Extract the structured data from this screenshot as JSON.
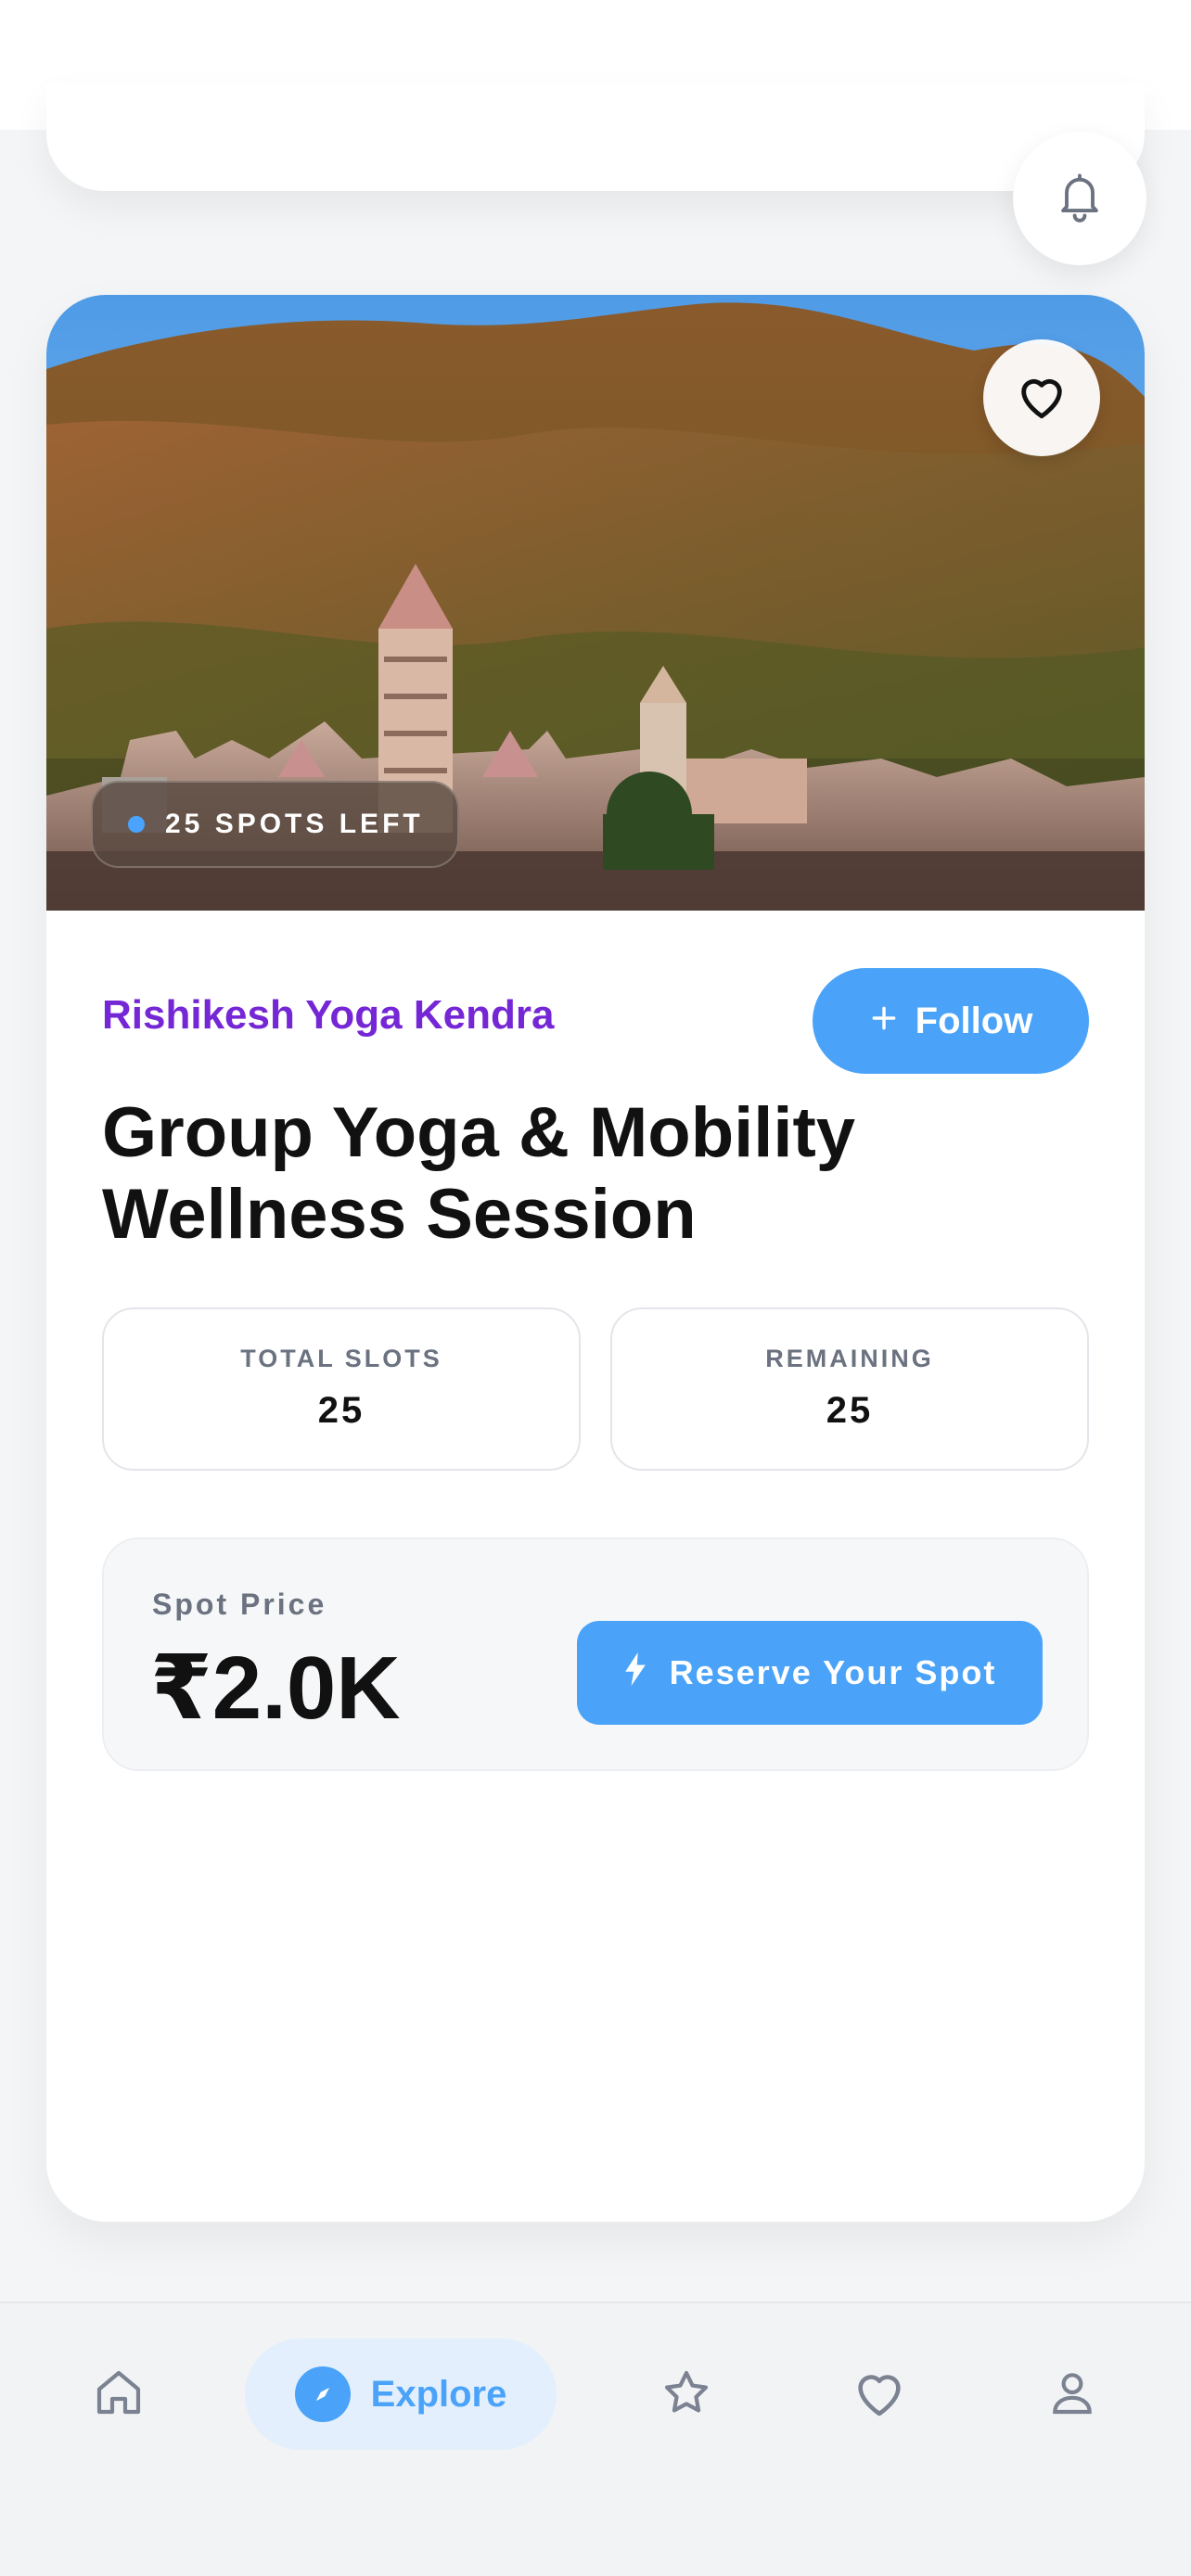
{
  "card": {
    "badge": "25 SPOTS LEFT",
    "organizer": "Rishikesh Yoga Kendra",
    "follow_label": "Follow",
    "title_line1": "Group Yoga & Mobility",
    "title_line2": "Wellness Session",
    "stats": [
      {
        "label": "TOTAL SLOTS",
        "value": "25"
      },
      {
        "label": "REMAINING",
        "value": "25"
      }
    ],
    "price_label": "Spot Price",
    "price_value": "₹2.0K",
    "reserve_label": "Reserve Your Spot"
  },
  "nav": {
    "items": [
      "home",
      "explore",
      "favorites-star",
      "likes",
      "profile"
    ],
    "active_label": "Explore"
  },
  "icons": {
    "header": "bell-icon",
    "hero": "heart-icon",
    "follow": "plus-icon",
    "reserve": "lightning-icon",
    "nav": [
      "home-icon",
      "compass-icon",
      "star-icon",
      "heart-icon",
      "user-icon"
    ]
  },
  "colors": {
    "accent": "#4aa3f8",
    "organizer": "#7527d6",
    "badge_dot": "#4aa3ff",
    "active_nav_bg": "#e3effd"
  }
}
